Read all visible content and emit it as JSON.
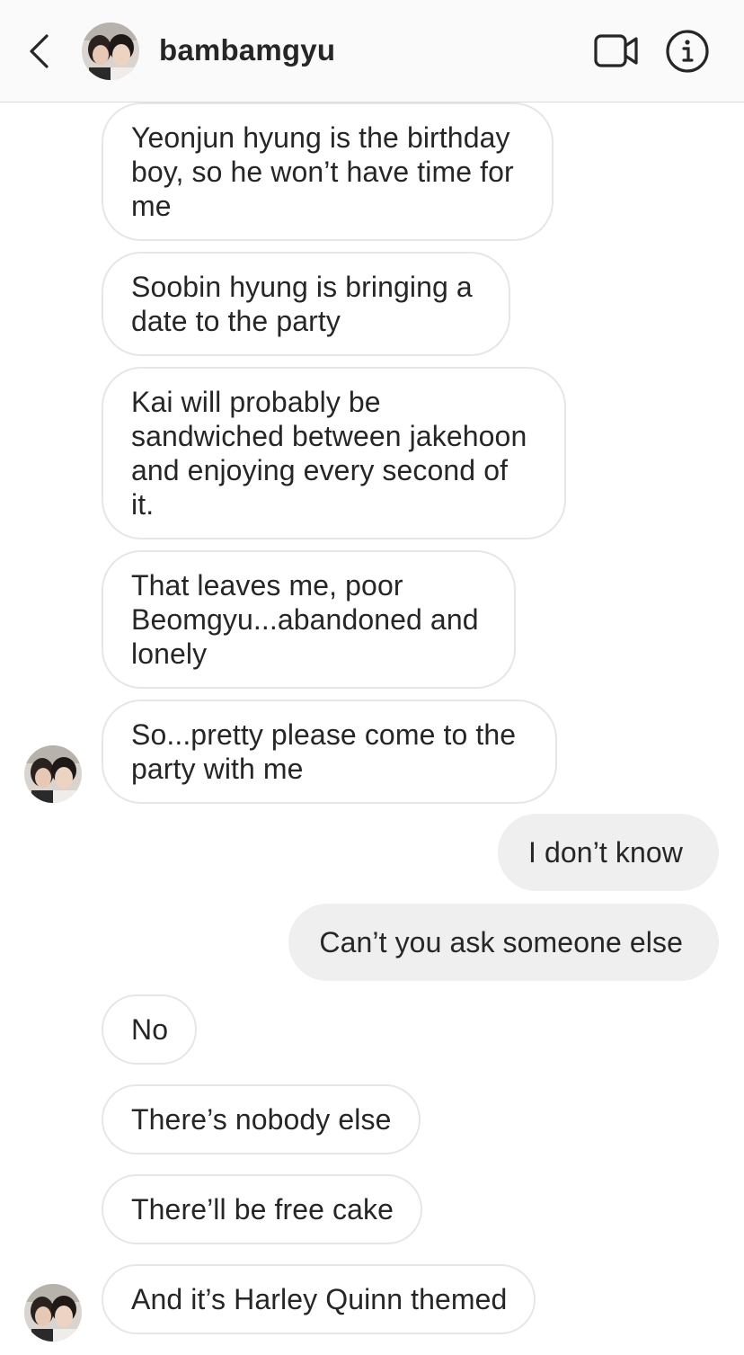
{
  "header": {
    "title": "bambamgyu",
    "back_icon": "chevron-left-icon",
    "video_icon": "video-camera-icon",
    "info_icon": "info-icon"
  },
  "messages": [
    {
      "direction": "incoming",
      "text": "Yeonjun hyung is the birthday boy, so he won’t have time for me"
    },
    {
      "direction": "incoming",
      "text": "Soobin hyung is bringing a date to the party"
    },
    {
      "direction": "incoming",
      "text": "Kai will probably be sandwiched between jakehoon and enjoying every second of it."
    },
    {
      "direction": "incoming",
      "text": "That leaves me, poor Beomgyu...abandoned and lonely"
    },
    {
      "direction": "incoming",
      "text": "So...pretty please come to the party with me"
    },
    {
      "direction": "outgoing",
      "text": "I don’t know"
    },
    {
      "direction": "outgoing",
      "text": "Can’t you ask someone else"
    },
    {
      "direction": "incoming",
      "text": "No"
    },
    {
      "direction": "incoming",
      "text": "There’s nobody else"
    },
    {
      "direction": "incoming",
      "text": "There’ll be free cake"
    },
    {
      "direction": "incoming",
      "text": "And it’s Harley Quinn themed"
    }
  ],
  "colors": {
    "header_bg": "#fafafa",
    "incoming_border": "#e6e6e6",
    "outgoing_bg": "#efefef",
    "text": "#262626"
  }
}
